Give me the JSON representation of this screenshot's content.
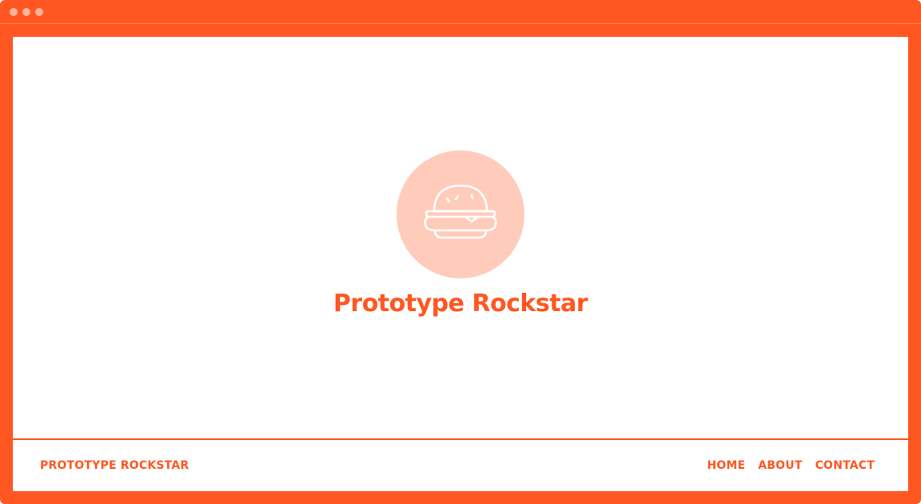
{
  "brand": {
    "title": "Prototype Rockstar",
    "footer_name": "PROTOTYPE ROCKSTAR",
    "logo_icon": "burger-icon"
  },
  "nav": {
    "items": [
      {
        "label": "HOME"
      },
      {
        "label": "ABOUT"
      },
      {
        "label": "CONTACT"
      }
    ]
  },
  "colors": {
    "accent": "#ff5722",
    "logo_bg": "#ffccbc",
    "window_dots": "#ffb399"
  }
}
